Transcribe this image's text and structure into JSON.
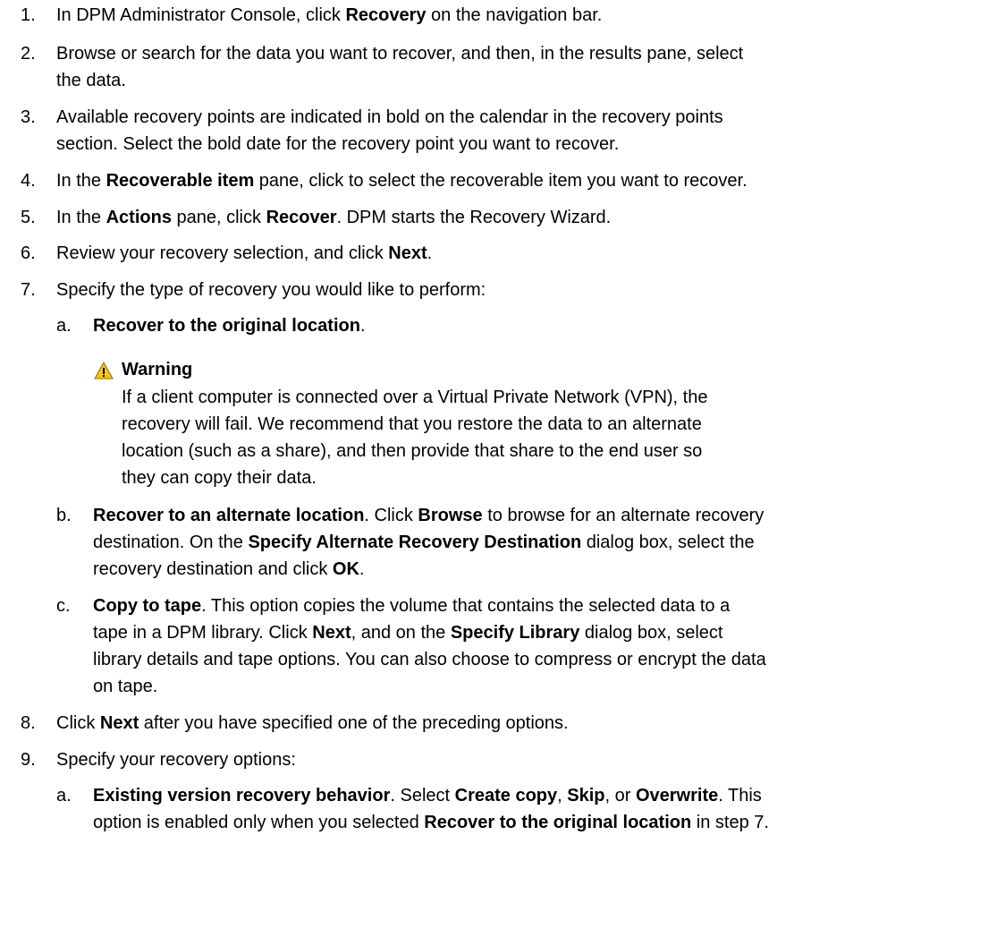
{
  "steps": [
    {
      "num": "1.",
      "lines": [
        [
          "In DPM Administrator Console, click ",
          {
            "b": "Recovery"
          },
          " on the navigation bar."
        ]
      ]
    },
    {
      "num": "2.",
      "lines": [
        [
          "Browse or search for the data you want to recover, and then, in the results pane, select"
        ],
        [
          "the data."
        ]
      ]
    },
    {
      "num": "3.",
      "lines": [
        [
          "Available recovery points are indicated in bold on the calendar in the recovery points"
        ],
        [
          "section. Select the bold date for the recovery point you want to recover."
        ]
      ]
    },
    {
      "num": "4.",
      "lines": [
        [
          "In the ",
          {
            "b": "Recoverable item"
          },
          " pane, click to select the recoverable item you want to recover."
        ]
      ]
    },
    {
      "num": "5.",
      "lines": [
        [
          "In the ",
          {
            "b": "Actions"
          },
          " pane, click ",
          {
            "b": "Recover"
          },
          ". DPM starts the Recovery Wizard."
        ]
      ]
    },
    {
      "num": "6.",
      "lines": [
        [
          "Review your recovery selection, and click ",
          {
            "b": "Next"
          },
          "."
        ]
      ]
    },
    {
      "num": "7.",
      "lines": [
        [
          "Specify the type of recovery you would like to perform:"
        ]
      ]
    },
    {
      "num": "a.",
      "lines": [
        [
          {
            "b": "Recover to the original location"
          },
          "."
        ]
      ]
    },
    {
      "num": "b.",
      "lines": [
        [
          {
            "b": "Recover to an alternate location"
          },
          ". Click ",
          {
            "b": "Browse"
          },
          " to browse for an alternate recovery"
        ],
        [
          "destination. On the ",
          {
            "b": "Specify Alternate Recovery Destination"
          },
          " dialog box, select the"
        ],
        [
          "recovery destination and click ",
          {
            "b": "OK"
          },
          "."
        ]
      ]
    },
    {
      "num": "c.",
      "lines": [
        [
          {
            "b": "Copy to tape"
          },
          ". This option copies the volume that contains the selected data to a"
        ],
        [
          "tape in a DPM library. Click ",
          {
            "b": "Next"
          },
          ", and on the ",
          {
            "b": "Specify Library"
          },
          " dialog box, select"
        ],
        [
          "library details and tape options. You can also choose to compress or encrypt the data"
        ],
        [
          "on tape."
        ]
      ]
    },
    {
      "num": "8.",
      "lines": [
        [
          "Click ",
          {
            "b": "Next"
          },
          " after you have specified one of the preceding options."
        ]
      ]
    },
    {
      "num": "9.",
      "lines": [
        [
          "Specify your recovery options:"
        ]
      ]
    },
    {
      "num": "a.",
      "lines": [
        [
          {
            "b": "Existing version recovery behavior"
          },
          ". Select ",
          {
            "b": "Create copy"
          },
          ", ",
          {
            "b": "Skip"
          },
          ", or ",
          {
            "b": "Overwrite"
          },
          ". This"
        ],
        [
          "option is enabled only when you selected ",
          {
            "b": "Recover to the original location"
          },
          " in step 7."
        ]
      ]
    }
  ],
  "warning": {
    "title": "Warning",
    "icon": "warning-triangle-icon",
    "icon_color": "#f5c518",
    "lines": [
      "If a client computer is connected over a Virtual Private Network (VPN), the",
      "recovery will fail. We recommend that you restore the data to an alternate",
      "location (such as a share), and then provide that share to the end user so",
      "they can copy their data."
    ]
  }
}
